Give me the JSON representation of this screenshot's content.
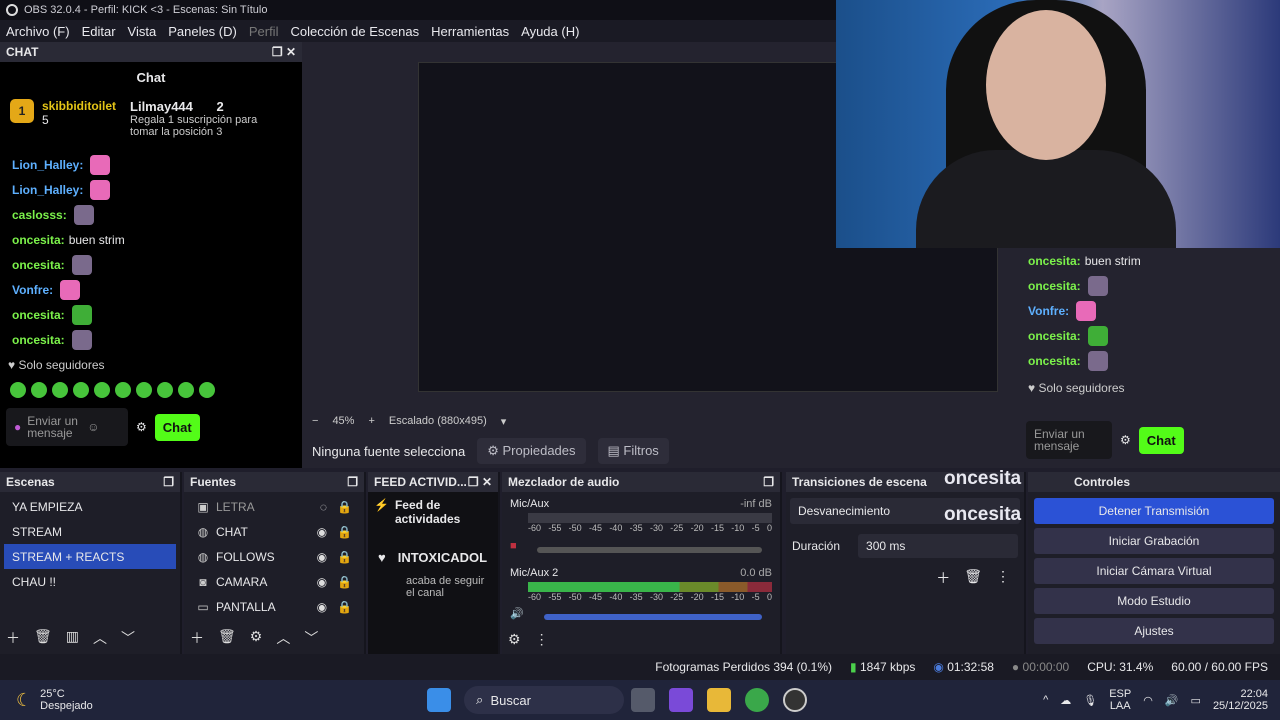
{
  "title": "OBS 32.0.4 - Perfil: KICK <3 - Escenas: Sin Título",
  "menu": [
    "Archivo (F)",
    "Editar",
    "Vista",
    "Paneles (D)",
    "Perfil",
    "Colección de Escenas",
    "Herramientas",
    "Ayuda (H)"
  ],
  "chat": {
    "dock_title": "CHAT",
    "title": "Chat",
    "lead1": {
      "rank": "1",
      "user": "skibbiditoilet",
      "count": "5"
    },
    "lead2": {
      "user": "Lilmay444",
      "count": "2",
      "note": "Regala 1 suscripción para tomar la posición 3"
    },
    "messages": [
      {
        "user": "Lion_Halley:",
        "text": "",
        "color": "#5eb0ff"
      },
      {
        "user": "Lion_Halley:",
        "text": "",
        "color": "#5eb0ff"
      },
      {
        "user": "caslosss:",
        "text": "",
        "color": "#7cf24b"
      },
      {
        "user": "oncesita:",
        "text": "buen strim",
        "color": "#7cf24b"
      },
      {
        "user": "oncesita:",
        "text": "",
        "color": "#7cf24b"
      },
      {
        "user": "Vonfre:",
        "text": "",
        "color": "#5eb0ff"
      },
      {
        "user": "oncesita:",
        "text": "",
        "color": "#7cf24b"
      },
      {
        "user": "oncesita:",
        "text": "",
        "color": "#7cf24b"
      }
    ],
    "followers": "Solo seguidores",
    "placeholder": "Enviar un mensaje",
    "send": "Chat"
  },
  "preview": {
    "zoom": "45%",
    "scale": "Escalado (880x495)",
    "no_source": "Ninguna fuente selecciona",
    "props": "Propiedades",
    "filters": "Filtros"
  },
  "rchat": {
    "messages": [
      {
        "user": "oncesita:",
        "text": "buen strim"
      },
      {
        "user": "oncesita:",
        "text": ""
      },
      {
        "user": "Vonfre:",
        "text": ""
      },
      {
        "user": "oncesita:",
        "text": ""
      },
      {
        "user": "oncesita:",
        "text": ""
      }
    ],
    "followers": "Solo seguidores",
    "placeholder": "Enviar un mensaje",
    "send": "Chat"
  },
  "scenes": {
    "title": "Escenas",
    "items": [
      "YA EMPIEZA",
      "STREAM",
      "STREAM + REACTS",
      "CHAU !!"
    ],
    "selected": 2
  },
  "sources": {
    "title": "Fuentes",
    "items": [
      {
        "name": "LETRA",
        "icon": "image-icon"
      },
      {
        "name": "CHAT",
        "icon": "browser-icon"
      },
      {
        "name": "FOLLOWS",
        "icon": "browser-icon"
      },
      {
        "name": "CAMARA",
        "icon": "camera-icon"
      },
      {
        "name": "PANTALLA",
        "icon": "monitor-icon"
      }
    ]
  },
  "feed": {
    "title": "FEED ACTIVID...",
    "header": "Feed de actividades",
    "user": "INTOXICADOL",
    "text": "acaba de seguir el canal"
  },
  "mixer": {
    "title": "Mezclador de audio",
    "ch1": {
      "name": "Mic/Aux",
      "db": "-inf dB"
    },
    "ch2": {
      "name": "Mic/Aux 2",
      "db": "0.0 dB"
    },
    "scale": [
      "-60",
      "-55",
      "-50",
      "-45",
      "-40",
      "-35",
      "-30",
      "-25",
      "-20",
      "-15",
      "-10",
      "-5",
      "0"
    ]
  },
  "transitions": {
    "title": "Transiciones de escena",
    "type": "Desvanecimiento",
    "duration_label": "Duración",
    "duration": "300 ms"
  },
  "controls": {
    "title": "Controles",
    "buttons": [
      "Detener Transmisión",
      "Iniciar Grabación",
      "Iniciar Cámara Virtual",
      "Modo Estudio",
      "Ajustes"
    ]
  },
  "overlay": {
    "name1": "oncesita",
    "name2": "oncesita"
  },
  "status": {
    "dropped": "Fotogramas Perdidos 394 (0.1%)",
    "kbps": "1847 kbps",
    "live": "01:32:58",
    "rec": "00:00:00",
    "cpu": "CPU: 31.4%",
    "fps": "60.00 / 60.00 FPS"
  },
  "taskbar": {
    "temp": "25°C",
    "weather": "Despejado",
    "search": "Buscar",
    "lang1": "ESP",
    "lang2": "LAA",
    "time": "22:04",
    "date": "25/12/2025"
  }
}
